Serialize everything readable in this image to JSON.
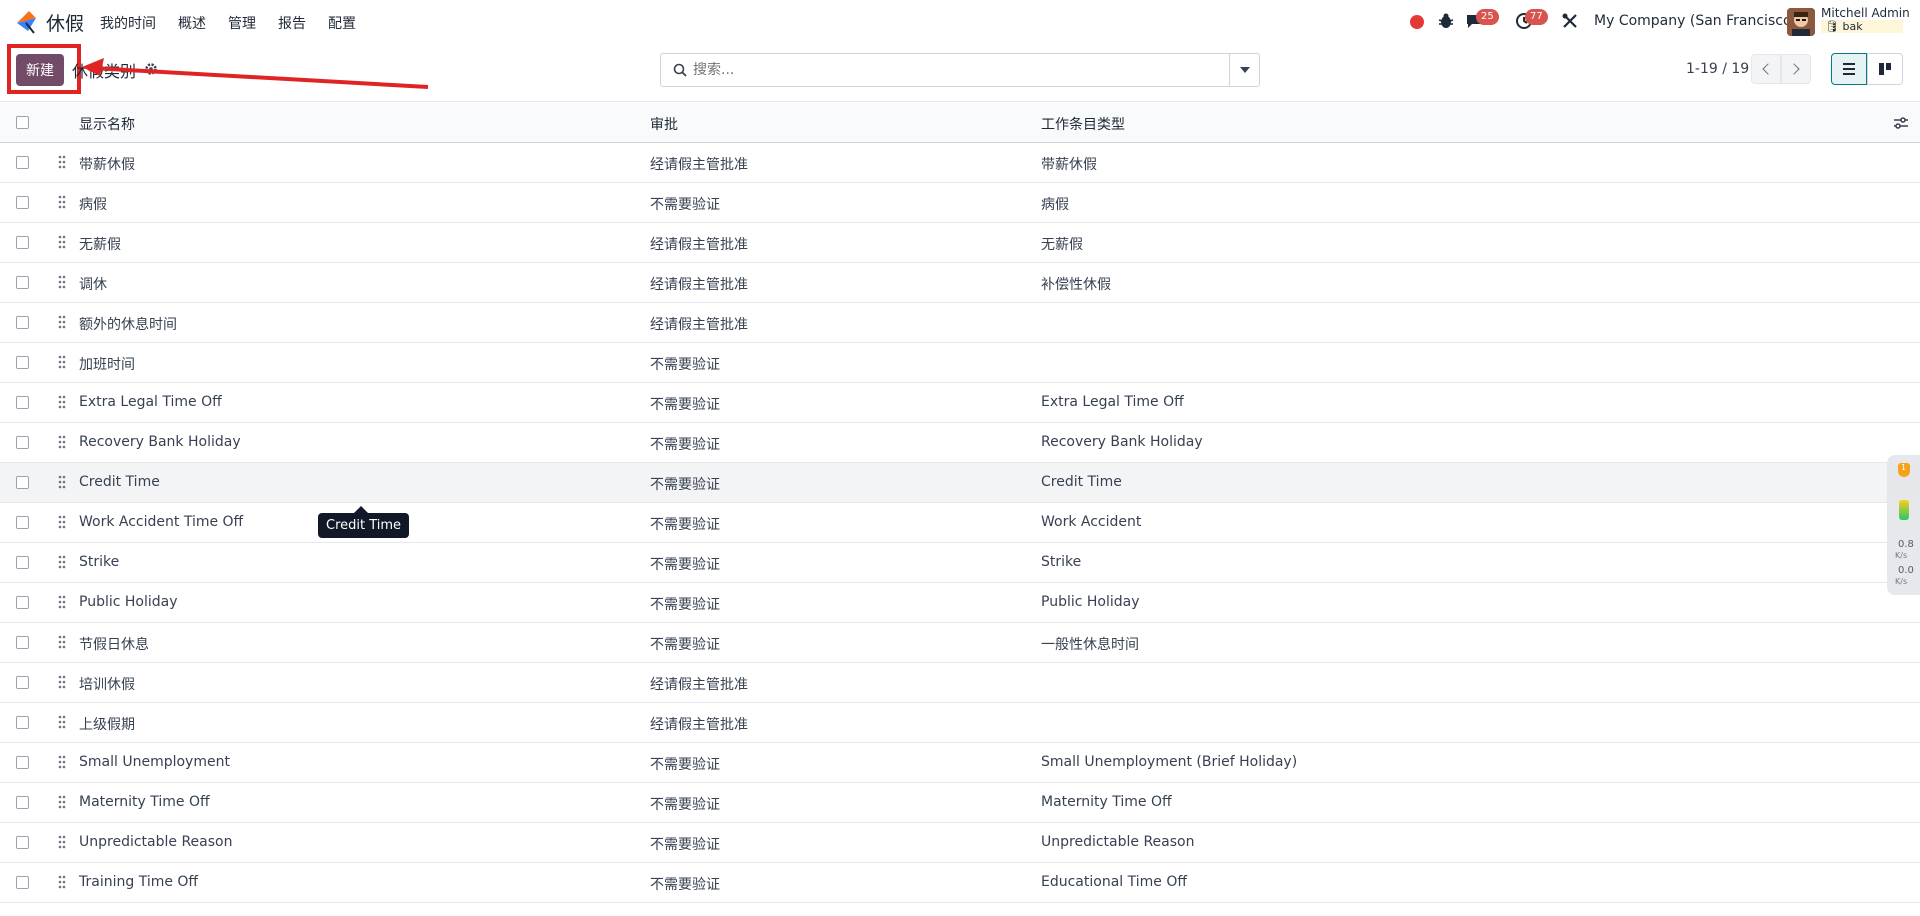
{
  "navbar": {
    "app_name": "休假",
    "menu": [
      "我的时间",
      "概述",
      "管理",
      "报告",
      "配置"
    ],
    "chat_count": "25",
    "activity_count": "77",
    "company": "My Company (San Francisco)",
    "user_name": "Mitchell Admin",
    "db_name": "bak"
  },
  "control_panel": {
    "new_label": "新建",
    "breadcrumb": "休假类别",
    "search_placeholder": "搜索...",
    "pager": "1-19 / 19"
  },
  "table": {
    "columns": [
      "显示名称",
      "审批",
      "工作条目类型"
    ],
    "rows": [
      [
        "带薪休假",
        "经请假主管批准",
        "带薪休假"
      ],
      [
        "病假",
        "不需要验证",
        "病假"
      ],
      [
        "无薪假",
        "经请假主管批准",
        "无薪假"
      ],
      [
        "调休",
        "经请假主管批准",
        "补偿性休假"
      ],
      [
        "额外的休息时间",
        "经请假主管批准",
        ""
      ],
      [
        "加班时间",
        "不需要验证",
        ""
      ],
      [
        "Extra Legal Time Off",
        "不需要验证",
        "Extra Legal Time Off"
      ],
      [
        "Recovery Bank Holiday",
        "不需要验证",
        "Recovery Bank Holiday"
      ],
      [
        "Credit Time",
        "不需要验证",
        "Credit Time"
      ],
      [
        "Work Accident Time Off",
        "不需要验证",
        "Work Accident"
      ],
      [
        "Strike",
        "不需要验证",
        "Strike"
      ],
      [
        "Public Holiday",
        "不需要验证",
        "Public Holiday"
      ],
      [
        "节假日休息",
        "不需要验证",
        "一般性休息时间"
      ],
      [
        "培训休假",
        "经请假主管批准",
        ""
      ],
      [
        "上级假期",
        "经请假主管批准",
        ""
      ],
      [
        "Small Unemployment",
        "不需要验证",
        "Small Unemployment (Brief Holiday)"
      ],
      [
        "Maternity Time Off",
        "不需要验证",
        "Maternity Time Off"
      ],
      [
        "Unpredictable Reason",
        "不需要验证",
        "Unpredictable Reason"
      ],
      [
        "Training Time Off",
        "不需要验证",
        "Educational Time Off"
      ]
    ],
    "hover_row": 8
  },
  "tooltip": "Credit Time",
  "widget": {
    "badge": "1",
    "up": "0.8",
    "up_unit": "K/s",
    "down": "0.0",
    "down_unit": "K/s"
  },
  "colors": {
    "primary": "#714b67",
    "annotation": "#e02424",
    "badge": "#d9534f"
  }
}
